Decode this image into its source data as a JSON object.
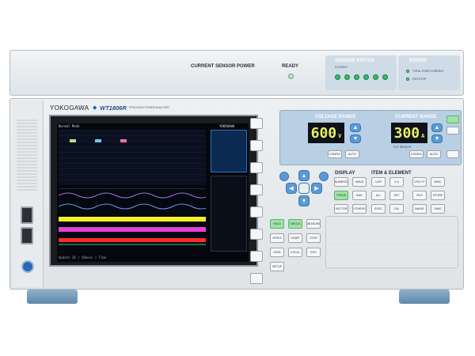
{
  "sensor_unit": {
    "current_sensor_power_label": "CURRENT SENSOR POWER",
    "ready_label": "READY",
    "sensor_status_label": "SENSOR STATUS",
    "sensor_status_sublabel": "ELEMENT",
    "error_label": "ERROR",
    "error_items": [
      "TOTAL OVER CURRENT",
      "FAN STOP"
    ]
  },
  "instrument": {
    "brand": "YOKOGAWA",
    "model": "WT1806R",
    "model_subtitle": "PRECISION POWER ANALYZER"
  },
  "screen": {
    "mode": "Normal Mode",
    "header_right": "YOKOGAWA",
    "status_bar": "Update 20 ( 50msec ) Time"
  },
  "voltage_range": {
    "label": "VOLTAGE RANGE",
    "value": "600",
    "unit": "V",
    "config_label": "CONFIG",
    "auto_label": "AUTO"
  },
  "current_range": {
    "label": "CURRENT RANGE",
    "value": "300",
    "unit": "A",
    "config_label": "CONFIG",
    "auto_label": "AUTO",
    "ext_sensor_label": "EXT SENSOR"
  },
  "display_section": {
    "label": "DISPLAY",
    "buttons": [
      "NUMERIC",
      "WAVE",
      "TREND",
      "BAR",
      "VECTOR",
      "OTHERS",
      "FORM",
      "ITEM"
    ]
  },
  "item_element_section": {
    "label": "ITEM & ELEMENT",
    "buttons": [
      "U/I/P",
      "Σ A",
      "ALL",
      "SET",
      "EXEC",
      "CAL"
    ]
  },
  "system_section": {
    "buttons": [
      "UTILITY",
      "MISC",
      "FILE",
      "STORE",
      "IMAGE",
      "SAVE",
      "RESET",
      "SHIFT"
    ]
  },
  "lower_controls": {
    "buttons": [
      "HOLD",
      "SINGLE",
      "MEASURE",
      "INTEG",
      "START",
      "STOP",
      "DATA",
      "LOCAL",
      "ESC",
      "SETUP"
    ]
  }
}
